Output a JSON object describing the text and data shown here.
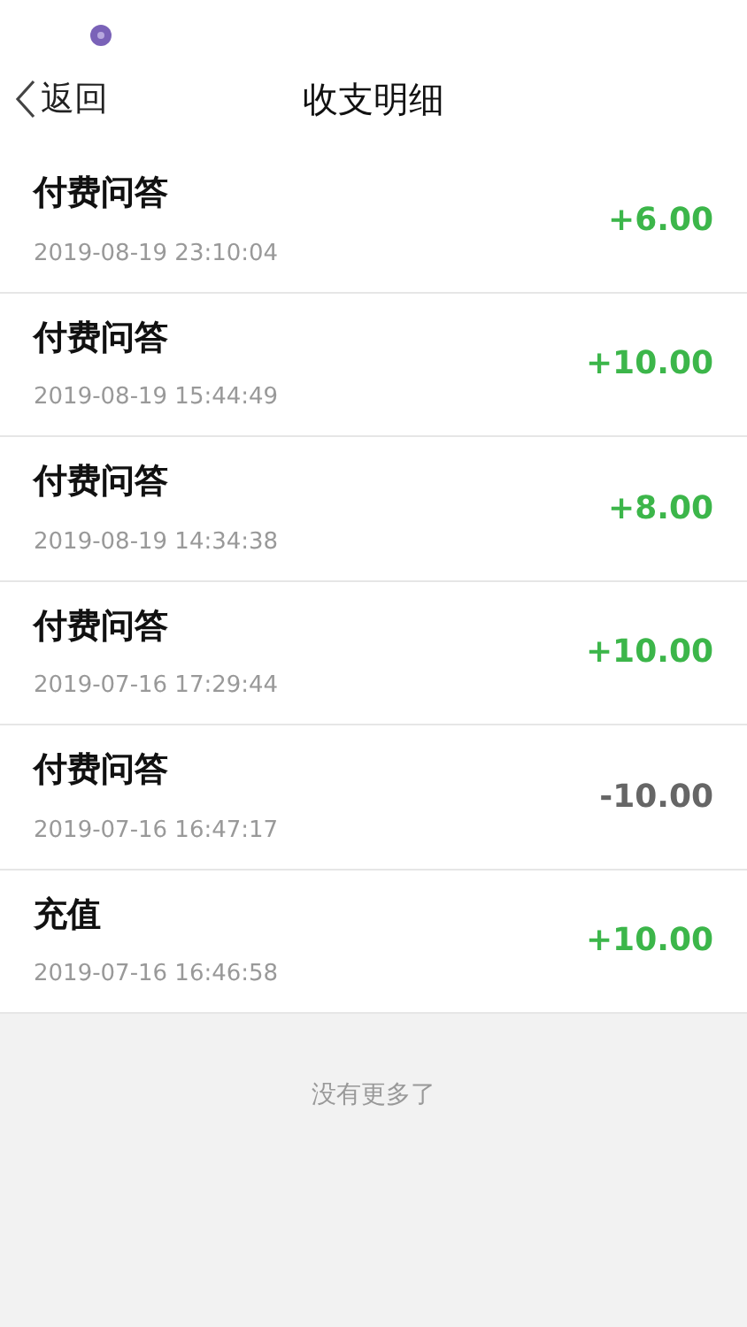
{
  "header": {
    "back": "返回",
    "title": "收支明细"
  },
  "records": [
    {
      "title": "付费问答",
      "time": "2019-08-19 23:10:04",
      "amount": "+6.00",
      "kind": "income"
    },
    {
      "title": "付费问答",
      "time": "2019-08-19 15:44:49",
      "amount": "+10.00",
      "kind": "income"
    },
    {
      "title": "付费问答",
      "time": "2019-08-19 14:34:38",
      "amount": "+8.00",
      "kind": "income"
    },
    {
      "title": "付费问答",
      "time": "2019-07-16 17:29:44",
      "amount": "+10.00",
      "kind": "income"
    },
    {
      "title": "付费问答",
      "time": "2019-07-16 16:47:17",
      "amount": "-10.00",
      "kind": "expense"
    },
    {
      "title": "充值",
      "time": "2019-07-16 16:46:58",
      "amount": "+10.00",
      "kind": "income"
    }
  ],
  "footer": "没有更多了"
}
